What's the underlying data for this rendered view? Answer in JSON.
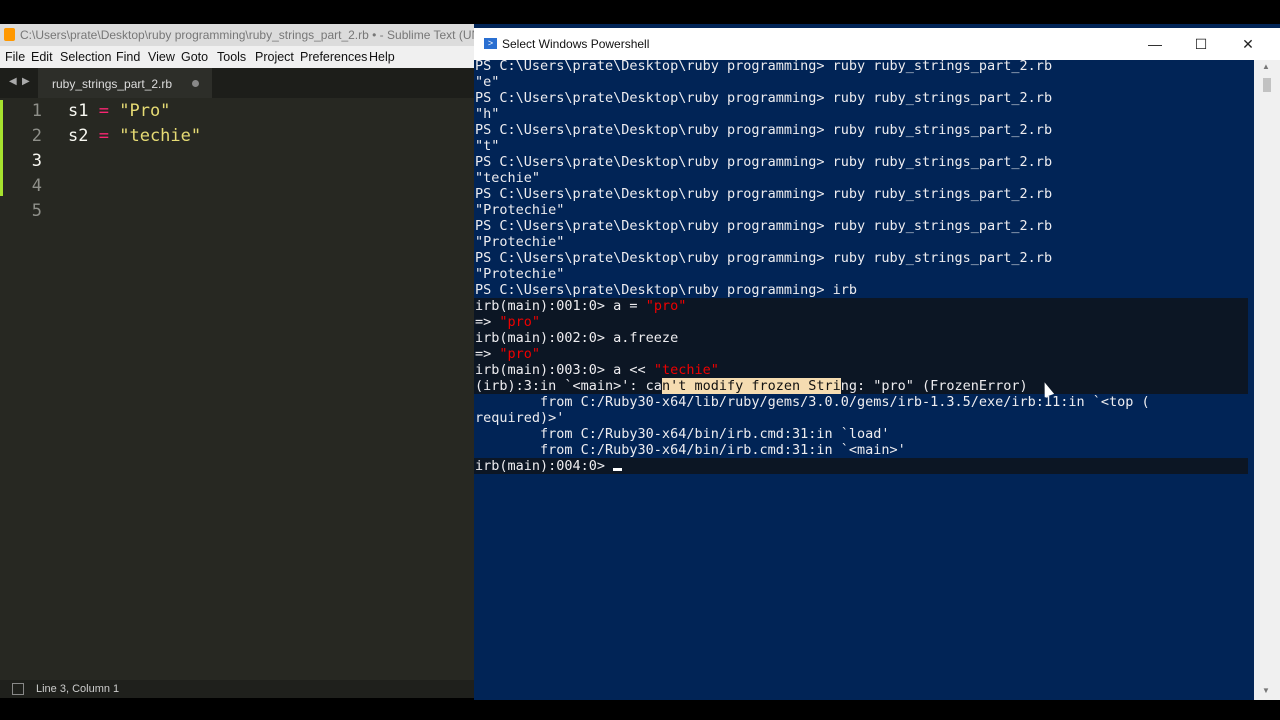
{
  "sublime": {
    "title": "C:\\Users\\prate\\Desktop\\ruby programming\\ruby_strings_part_2.rb • - Sublime Text (UN",
    "menu": [
      "File",
      "Edit",
      "Selection",
      "Find",
      "View",
      "Goto",
      "Tools",
      "Project",
      "Preferences",
      "Help"
    ],
    "tab_label": "ruby_strings_part_2.rb",
    "line_numbers": [
      "1",
      "2",
      "3",
      "4",
      "5"
    ],
    "code": {
      "l1_var": "s1",
      "l1_op": "=",
      "l1_str": "\"Pro\"",
      "l2_var": "s2",
      "l2_op": "=",
      "l2_str": "\"techie\""
    },
    "status": "Line 3, Column 1"
  },
  "powershell": {
    "title": "Select Windows Powershell",
    "controls": {
      "minimize": "—",
      "maximize": "☐",
      "close": "✕"
    },
    "lines": [
      "PS C:\\Users\\prate\\Desktop\\ruby programming> ruby ruby_strings_part_2.rb",
      "\"e\"",
      "PS C:\\Users\\prate\\Desktop\\ruby programming> ruby ruby_strings_part_2.rb",
      "\"h\"",
      "PS C:\\Users\\prate\\Desktop\\ruby programming> ruby ruby_strings_part_2.rb",
      "\"t\"",
      "PS C:\\Users\\prate\\Desktop\\ruby programming> ruby ruby_strings_part_2.rb",
      "\"techie\"",
      "PS C:\\Users\\prate\\Desktop\\ruby programming> ruby ruby_strings_part_2.rb",
      "\"Protechie\"",
      "PS C:\\Users\\prate\\Desktop\\ruby programming> ruby ruby_strings_part_2.rb",
      "\"Protechie\"",
      "PS C:\\Users\\prate\\Desktop\\ruby programming> ruby ruby_strings_part_2.rb",
      "\"Protechie\"",
      "PS C:\\Users\\prate\\Desktop\\ruby programming> irb"
    ],
    "irb": {
      "p1": "irb(main):001:0> a = ",
      "p1_str": "\"pro\"",
      "r1": "=> ",
      "r1_str": "\"pro\"",
      "p2": "irb(main):002:0> a.freeze",
      "r2": "=> ",
      "r2_str": "\"pro\"",
      "p3": "irb(main):003:0> a << ",
      "p3_str": "\"techie\"",
      "err_a": "(irb):3:in `<main>': ca",
      "err_sel": "n't modify frozen Stri",
      "err_b": "ng: \"pro\" (FrozenError)",
      "trace1": "        from C:/Ruby30-x64/lib/ruby/gems/3.0.0/gems/irb-1.3.5/exe/irb:11:in `<top (",
      "trace1b": "required)>'",
      "trace2": "        from C:/Ruby30-x64/bin/irb.cmd:31:in `load'",
      "trace3": "        from C:/Ruby30-x64/bin/irb.cmd:31:in `<main>'",
      "p4": "irb(main):004:0> "
    }
  }
}
